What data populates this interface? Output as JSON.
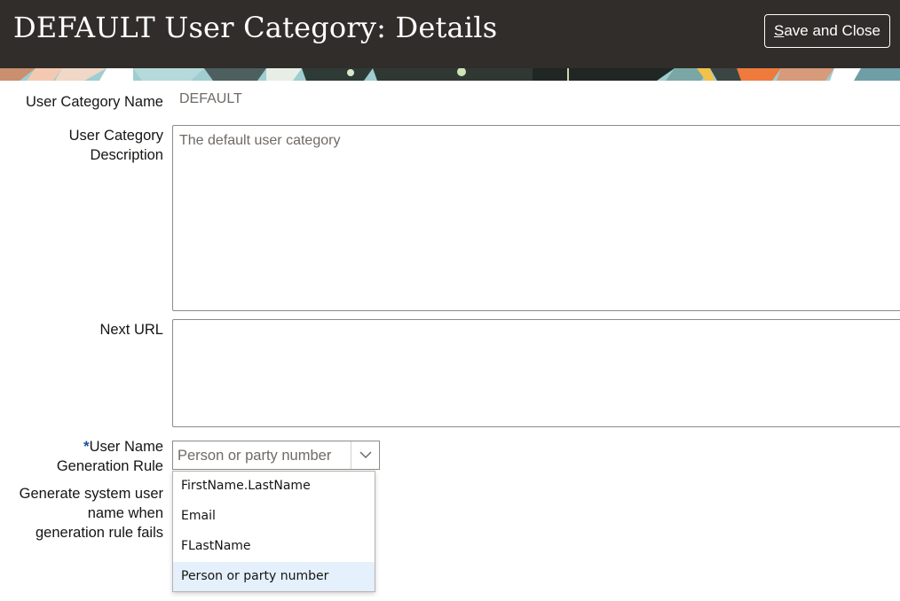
{
  "header": {
    "title": "DEFAULT User Category: Details",
    "save_close": {
      "mnemonic": "S",
      "rest": "ave and Close"
    }
  },
  "form": {
    "name_label": "User Category Name",
    "name_value": "DEFAULT",
    "desc_label_line1": "User Category",
    "desc_label_line2": "Description",
    "desc_value": "The default user category",
    "next_url_label": "Next URL",
    "next_url_value": "",
    "required_marker": "*",
    "rule_label_line1": "User Name",
    "rule_label_line2": "Generation Rule",
    "rule_value": "Person or party number",
    "fallback_label_line1": "Generate system user",
    "fallback_label_line2": "name when",
    "fallback_label_line3": "generation rule fails"
  },
  "dropdown": {
    "options": [
      "FirstName.LastName",
      "Email",
      "FLastName",
      "Person or party number"
    ],
    "selected_index": 3
  },
  "icons": {
    "chevron": "chevron-down-icon"
  },
  "colors": {
    "header_bg": "#312d2a",
    "accent": "#1a4f9e",
    "selected_option_bg": "#e4f0fb"
  }
}
